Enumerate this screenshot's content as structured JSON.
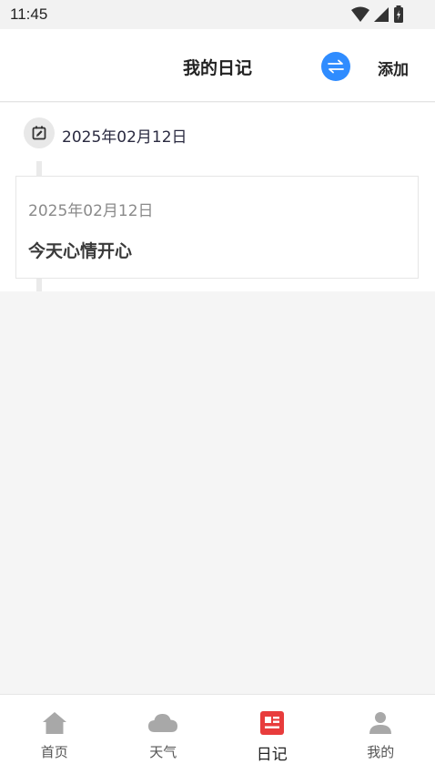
{
  "status_bar": {
    "time": "11:45"
  },
  "header": {
    "title": "我的日记",
    "add_label": "添加"
  },
  "timeline": {
    "date": "2025年02月12日",
    "entries": [
      {
        "date": "2025年02月12日",
        "title": "今天心情开心"
      }
    ]
  },
  "tab_bar": {
    "tabs": [
      {
        "label": "首页",
        "icon": "home-icon"
      },
      {
        "label": "天气",
        "icon": "cloud-icon"
      },
      {
        "label": "日记",
        "icon": "diary-icon",
        "active": true
      },
      {
        "label": "我的",
        "icon": "user-icon"
      }
    ]
  },
  "colors": {
    "accent": "#2f8cff",
    "active_tab": "#e83c3c",
    "inactive_icon": "#a8a8a8"
  }
}
